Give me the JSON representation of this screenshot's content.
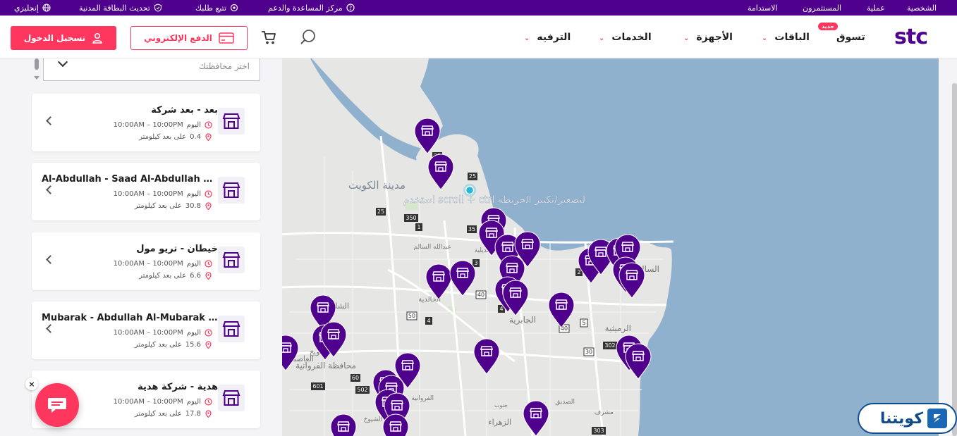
{
  "topbar": {
    "personal": "الشخصية",
    "business": "عملية",
    "investors": "المستثمرون",
    "sustainability": "الاستدامة",
    "help_center": "مركز المساعدة والدعم",
    "track_order": "تتبع طلبك",
    "civil_id": "تحديث البطاقة المدنية",
    "language": "إنجليزي"
  },
  "header": {
    "logo": "stc",
    "nav": [
      {
        "label": "تسوق",
        "badge": "جديد"
      },
      {
        "label": "الباقات"
      },
      {
        "label": "الأجهزة"
      },
      {
        "label": "الخدمات"
      },
      {
        "label": "الترفيه"
      }
    ],
    "epay_label": "الدفع الإلكتروني",
    "login_label": "تسجيل الدخول"
  },
  "filter": {
    "placeholder": "اختر محافظتك"
  },
  "stores": [
    {
      "name": "بعد - بعد شركة",
      "hours_label": "اليوم",
      "hours": "10:00AM – 10:00PM",
      "distance": "0.4",
      "distance_suffix": "على بعد كيلومتر"
    },
    {
      "name": "Al-Abdullah - Saad Al-Abdullah Co...",
      "hours_label": "اليوم",
      "hours": "10:00AM – 10:00PM",
      "distance": "30.8",
      "distance_suffix": "على بعد كيلومتر"
    },
    {
      "name": "خيطان - تريو مول",
      "hours_label": "اليوم",
      "hours": "10:00AM – 10:00PM",
      "distance": "6.6",
      "distance_suffix": "على بعد كيلومتر"
    },
    {
      "name": "Mubarak - Abdullah Al-Mubarak Co...",
      "hours_label": "اليوم",
      "hours": "10:00AM – 10:00PM",
      "distance": "15.6",
      "distance_suffix": "على بعد كيلومتر"
    },
    {
      "name": "هدية - شركة هدية",
      "hours_label": "اليوم",
      "hours": "10:00AM – 10:00PM",
      "distance": "17.8",
      "distance_suffix": "على بعد كيلومتر"
    }
  ],
  "map": {
    "scroll_hint": "استخدم scroll + ctrl لتصغير/تكبير الخريطة",
    "city_label": "مدينة الكويت",
    "places": [
      "عبدالله السالم",
      "الشامية",
      "العديلية",
      "الخالدية",
      "الجابرية",
      "الرميثية",
      "السالمية",
      "الشويخ",
      "العاصمة",
      "محافظة الفروانية",
      "الزهراء",
      "مشرف",
      "جليب الشيوخ",
      "جنوب",
      "الفروانية",
      "الصديق"
    ],
    "road_numbers": [
      "25",
      "25",
      "25",
      "350",
      "1",
      "35",
      "3",
      "40",
      "4",
      "50",
      "4",
      "40",
      "5",
      "30",
      "302",
      "60",
      "601",
      "502",
      "303",
      "2"
    ]
  },
  "watermark": {
    "text": "كويتنا"
  },
  "colors": {
    "brand_purple": "#4f008c",
    "accent_pink": "#ff375e",
    "water": "#8fb1cd",
    "land": "#e6e6e4"
  }
}
